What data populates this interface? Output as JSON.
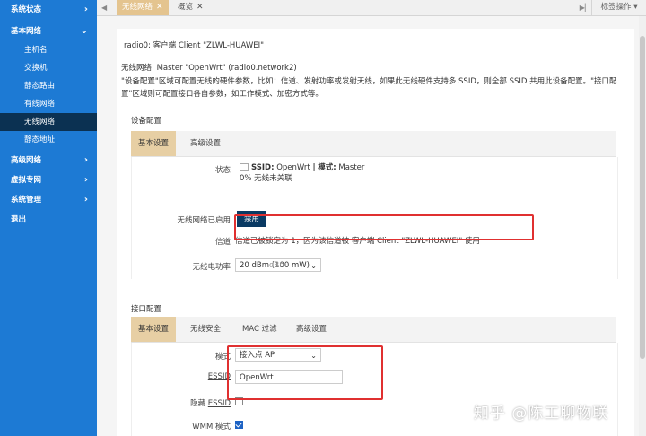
{
  "sidebar": {
    "groups": [
      {
        "label": "系统状态",
        "expanded": false
      },
      {
        "label": "基本网络",
        "expanded": true,
        "items": [
          "主机名",
          "交换机",
          "静态路由",
          "有线网络",
          "无线网络",
          "静态地址"
        ]
      },
      {
        "label": "高级网络",
        "expanded": false
      },
      {
        "label": "虚拟专网",
        "expanded": false
      },
      {
        "label": "系统管理",
        "expanded": false
      },
      {
        "label": "退出",
        "expanded": false
      }
    ],
    "active_item": "无线网络"
  },
  "tabs": {
    "items": [
      {
        "label": "无线网络",
        "active": true
      },
      {
        "label": "概览",
        "active": false
      }
    ],
    "close_glyph": "✕",
    "ops_label": "标签操作"
  },
  "header": {
    "client_line": "radio0: 客户端 Client \"ZLWL-HUAWEI\"",
    "network_line": "无线网络: Master \"OpenWrt\" (radio0.network2)",
    "desc_line1": "\"设备配置\"区域可配置无线的硬件参数，比如：信道、发射功率或发射天线，如果此无线硬件支持多 SSID，则全部 SSID 共用此设备配置。\"接口配",
    "desc_line2": "置\"区域则可配置接口各自参数，如工作模式、加密方式等。"
  },
  "device_config": {
    "title": "设备配置",
    "tabs": [
      "基本设置",
      "高级设置"
    ],
    "status_label": "状态",
    "status_ssid_key": "SSID:",
    "status_ssid_value": "OpenWrt",
    "status_sep": "|",
    "status_mode_key": "模式:",
    "status_mode_value": "Master",
    "status_signal": "0% 无线未关联",
    "enabled_label": "无线网络已启用",
    "disable_button": "禁用",
    "channel_label": "信道",
    "channel_note": "信道已被锁定为 1，因为该信道被 客户端 Client \"ZLWL-HUAWEI\" 使用",
    "txpower_label": "无线电功率",
    "txpower_value": "20 dBm (100 mW)",
    "txpower_unit": "dBm"
  },
  "iface_config": {
    "title": "接口配置",
    "tabs": [
      "基本设置",
      "无线安全",
      "MAC 过滤",
      "高级设置"
    ],
    "mode_label": "模式",
    "mode_value": "接入点 AP",
    "essid_label": "ESSID",
    "essid_value": "OpenWrt",
    "hide_label_prefix": "隐藏",
    "hide_label_essid": "ESSID",
    "hide_checked": false,
    "wmm_label": "WMM 模式",
    "wmm_checked": true
  },
  "watermark": "知乎 @陈工聊物联",
  "colors": {
    "sidebar_bg": "#1d7ad4",
    "sidebar_active": "#0b3152",
    "tab_active": "#e4c48f",
    "subtab_active": "#e7cfa4",
    "button_dark": "#0a3a63",
    "highlight_red": "#e03030"
  },
  "icons": {
    "chevron": "chevron-right-icon",
    "chevron_open": "chevron-down-icon",
    "tab_prev": "double-left-icon",
    "tab_next": "double-right-icon"
  }
}
